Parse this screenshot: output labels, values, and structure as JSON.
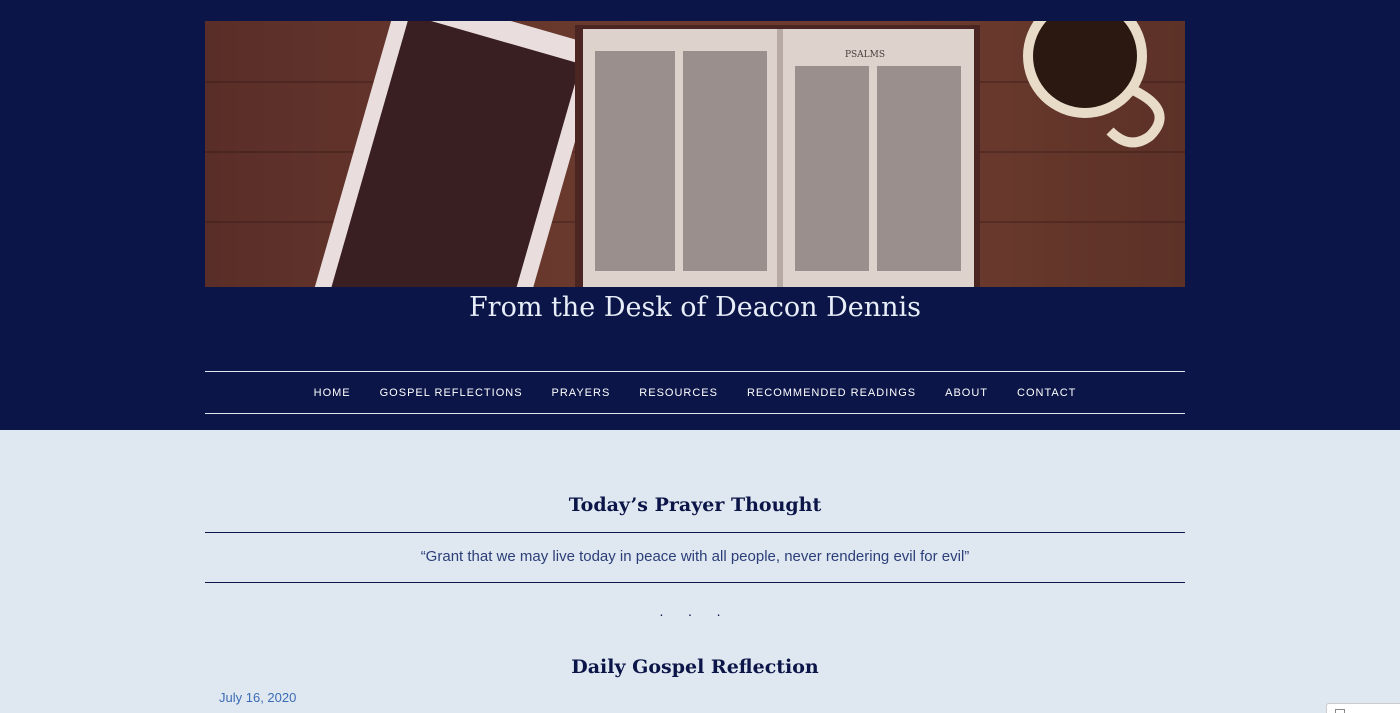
{
  "site": {
    "title": "From the Desk of Deacon Dennis",
    "header_image": "open-bible-psalms-tablet-coffee-image",
    "header_book_label": "PSALMS"
  },
  "nav": {
    "items": [
      {
        "label": "HOME"
      },
      {
        "label": "GOSPEL REFLECTIONS"
      },
      {
        "label": "PRAYERS"
      },
      {
        "label": "RESOURCES"
      },
      {
        "label": "RECOMMENDED READINGS"
      },
      {
        "label": "ABOUT"
      },
      {
        "label": "CONTACT"
      }
    ]
  },
  "prayer": {
    "title": "Today’s Prayer Thought",
    "quote": "“Grant that we may live today in peace with all people, never rendering evil for evil”"
  },
  "separator": "· · ·",
  "gospel": {
    "title": "Daily Gospel Reflection",
    "date": "July 16, 2020"
  },
  "colors": {
    "header_bg": "#0b1548",
    "page_bg": "#dfe8f1",
    "link": "#3b6bb5"
  }
}
